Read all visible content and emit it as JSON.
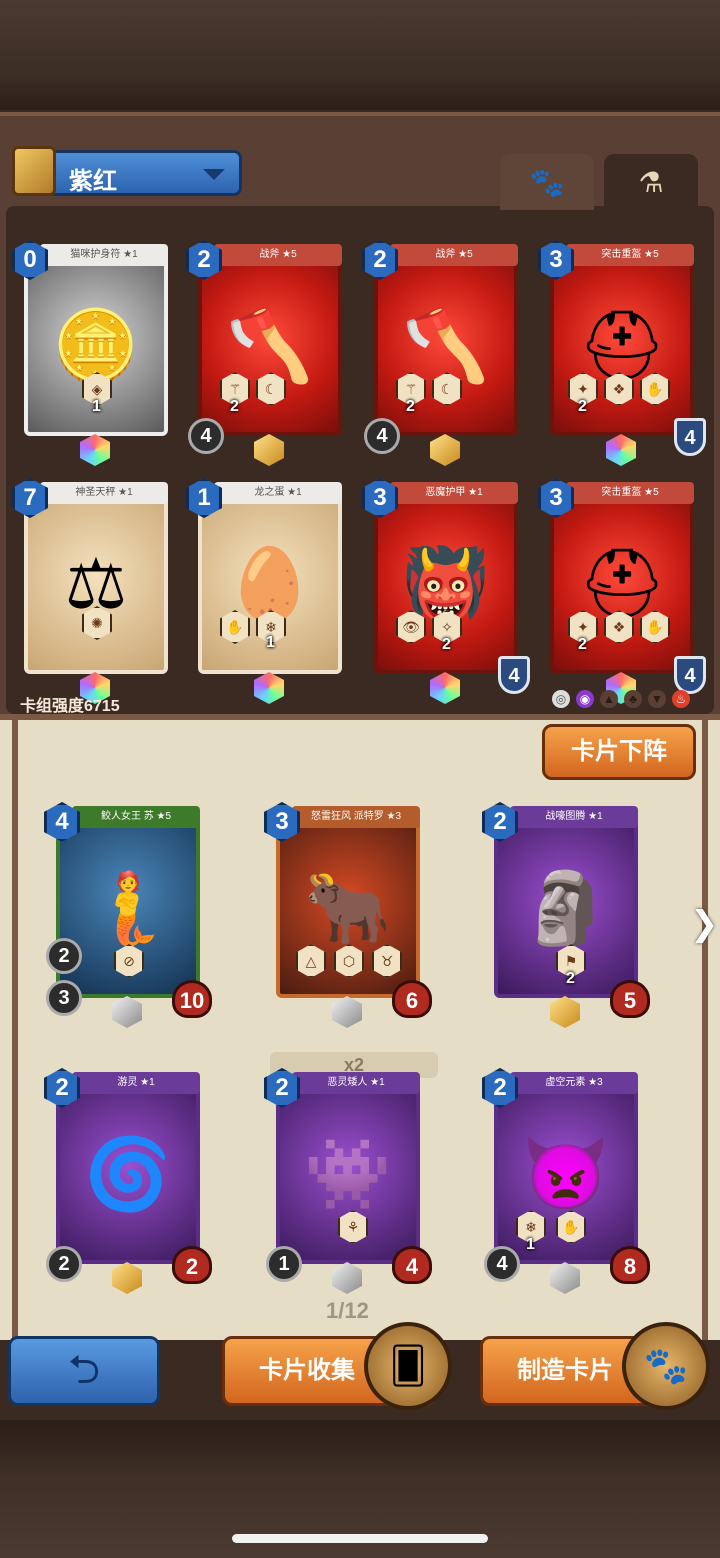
{
  "deck": {
    "name": "紫红",
    "strength_label": "卡组强度6715",
    "tabs": [
      {
        "icon": "paw-icon"
      },
      {
        "icon": "potion-icon"
      }
    ],
    "cards": [
      {
        "cost": "0",
        "name": "猫咪护身符 ★1",
        "frame": "silver",
        "glyph": "🪙",
        "stat1": "1",
        "gem": "rainbow",
        "hp": ""
      },
      {
        "cost": "2",
        "name": "战斧 ★5",
        "frame": "red",
        "glyph": "🪓",
        "stat1": "2",
        "atk": "4",
        "gem": "gold",
        "hp": ""
      },
      {
        "cost": "2",
        "name": "战斧 ★5",
        "frame": "red",
        "glyph": "🪓",
        "stat1": "2",
        "atk": "4",
        "gem": "gold",
        "hp": ""
      },
      {
        "cost": "3",
        "name": "突击重盔 ★5",
        "frame": "red",
        "glyph": "⛑",
        "stat1": "2",
        "gem": "rainbow",
        "hp": "4"
      },
      {
        "cost": "7",
        "name": "神圣天秤 ★1",
        "frame": "cream",
        "glyph": "⚖",
        "gem": "rainbow",
        "hp": ""
      },
      {
        "cost": "1",
        "name": "龙之蛋 ★1",
        "frame": "cream",
        "glyph": "🥚",
        "stat1": "1",
        "gem": "rainbow",
        "hp": ""
      },
      {
        "cost": "3",
        "name": "恶魔护甲 ★1",
        "frame": "red",
        "glyph": "👹",
        "stat1": "2",
        "gem": "rainbow",
        "hp": "4"
      },
      {
        "cost": "3",
        "name": "突击重盔 ★5",
        "frame": "red",
        "glyph": "⛑",
        "stat1": "2",
        "gem": "rainbow",
        "hp": "4"
      }
    ]
  },
  "collection": {
    "unequip_button": "卡片下阵",
    "duplicate_badge": "x2",
    "page": "1/12",
    "cards": [
      {
        "cost": "4",
        "name": "鲛人女王 苏 ★5",
        "frame": "green",
        "glyph": "🧜",
        "atk": "3",
        "hp": "10",
        "extra": "2",
        "gem": "silver"
      },
      {
        "cost": "3",
        "name": "怒雷狂风 派特罗 ★3",
        "frame": "orange",
        "glyph": "🐂",
        "atk": "",
        "hp": "6",
        "gem": "silver"
      },
      {
        "cost": "2",
        "name": "战嚎图腾 ★1",
        "frame": "purple",
        "glyph": "🗿",
        "atk": "",
        "hp": "5",
        "extra": "2",
        "gem": "gold"
      },
      {
        "cost": "2",
        "name": "游灵 ★1",
        "frame": "purple",
        "glyph": "🌀",
        "atk": "2",
        "hp": "2",
        "gem": "gold"
      },
      {
        "cost": "2",
        "name": "恶灵矮人 ★1",
        "frame": "purple",
        "glyph": "👾",
        "atk": "1",
        "hp": "4",
        "gem": "silver"
      },
      {
        "cost": "2",
        "name": "虚空元素 ★3",
        "frame": "purple",
        "glyph": "👿",
        "atk": "4",
        "hp": "8",
        "extra": "1",
        "gem": "silver"
      }
    ]
  },
  "bottom": {
    "collect_label": "卡片收集",
    "craft_label": "制造卡片"
  }
}
